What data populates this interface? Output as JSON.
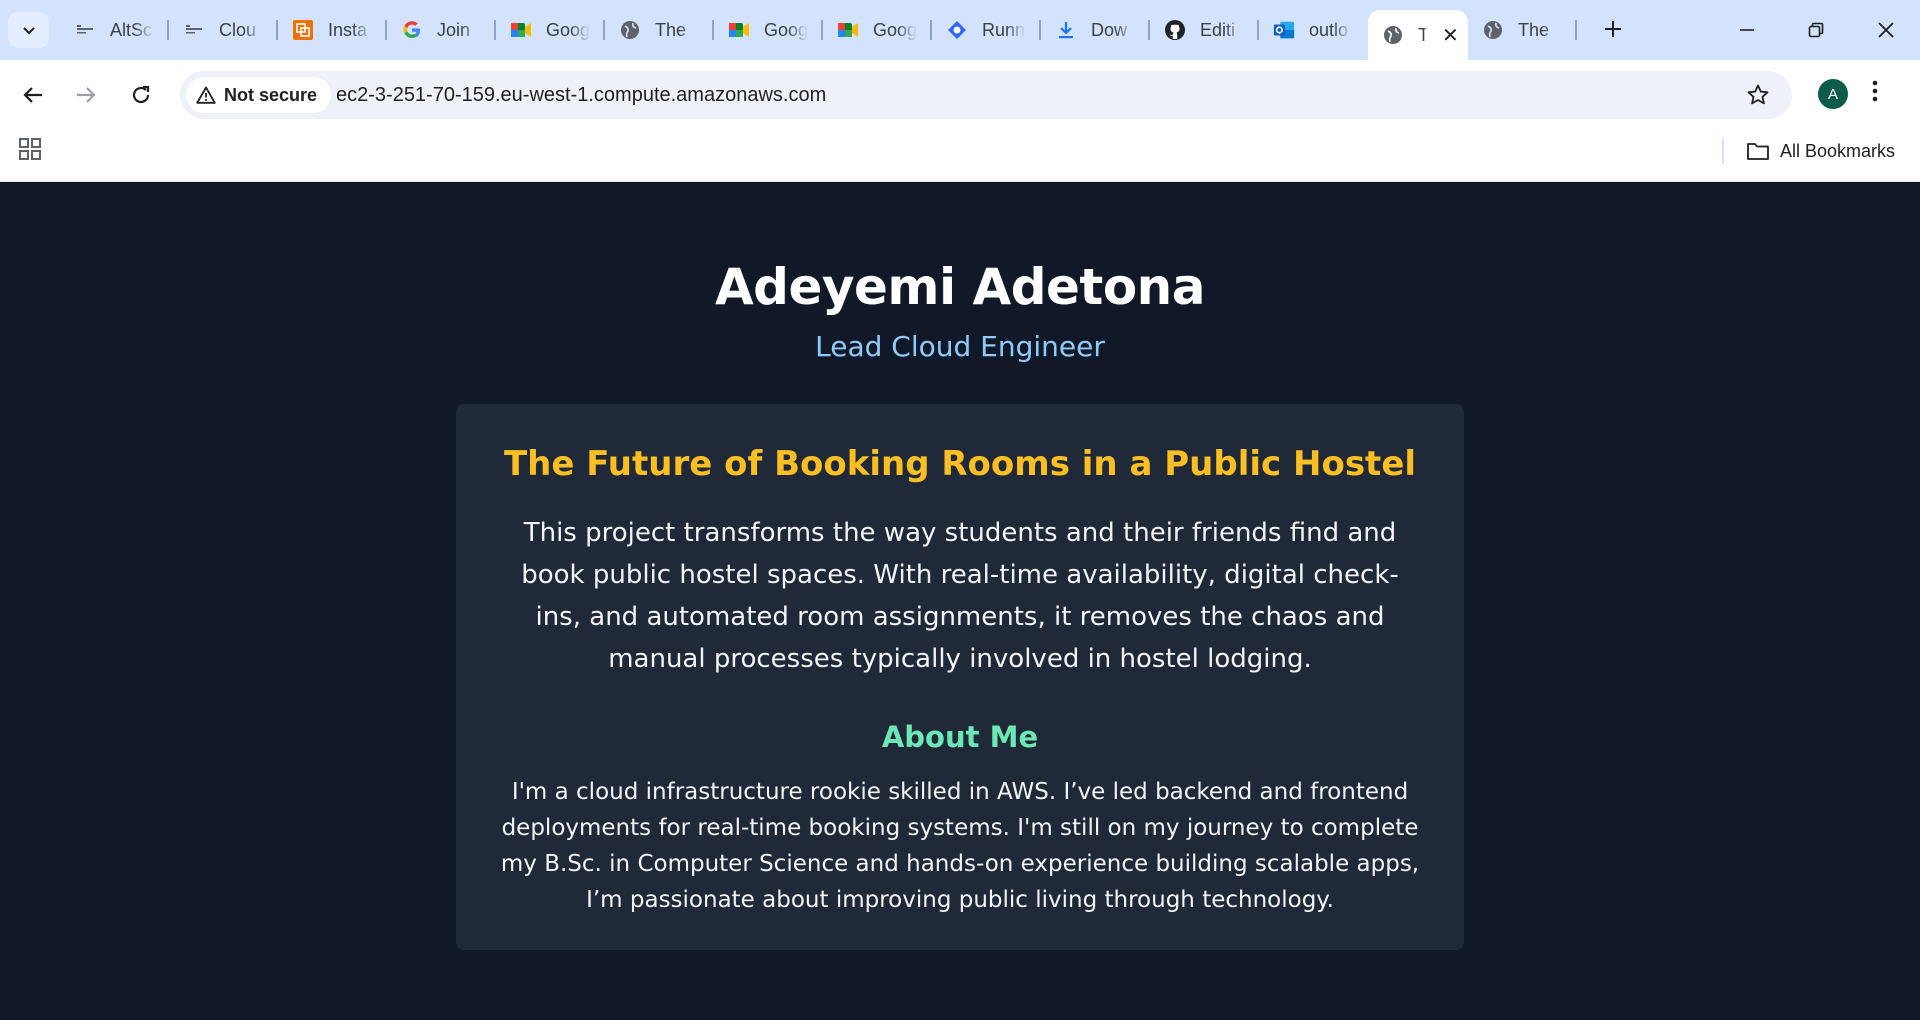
{
  "browser": {
    "tabs": [
      {
        "title": "AltSc",
        "icon": "folder-icon"
      },
      {
        "title": "Clou",
        "icon": "folder-icon"
      },
      {
        "title": "Insta",
        "icon": "aws-instance-icon"
      },
      {
        "title": "Join",
        "icon": "google-icon"
      },
      {
        "title": "Goog",
        "icon": "google-meet-icon"
      },
      {
        "title": "The",
        "icon": "globe-icon"
      },
      {
        "title": "Goog",
        "icon": "google-meet-icon"
      },
      {
        "title": "Goog",
        "icon": "google-meet-icon"
      },
      {
        "title": "Runn",
        "icon": "run-icon"
      },
      {
        "title": "Dow",
        "icon": "download-icon"
      },
      {
        "title": "Editi",
        "icon": "github-icon"
      },
      {
        "title": "outlo",
        "icon": "outlook-icon"
      },
      {
        "title": "T",
        "icon": "globe-icon",
        "active": true
      },
      {
        "title": "The",
        "icon": "globe-icon"
      }
    ],
    "security_label": "Not secure",
    "url": "ec2-3-251-70-159.eu-west-1.compute.amazonaws.com",
    "profile_initial": "A",
    "bookmarks_label": "All Bookmarks"
  },
  "profile": {
    "name": "Adeyemi Adetona",
    "role": "Lead Cloud Engineer"
  },
  "project": {
    "title": "The Future of Booking Rooms in a Public Hostel",
    "description": "This project transforms the way students and their friends find and book public hostel spaces. With real-time availability, digital check-ins, and automated room assignments, it removes the chaos and manual processes typically involved in hostel lodging."
  },
  "about": {
    "heading": "About Me",
    "text": "I'm a cloud infrastructure rookie skilled in AWS. I’ve led backend and frontend deployments for real-time booking systems. I'm still on my journey to complete my B.Sc. in Computer Science and hands-on experience building scalable apps, I’m passionate about improving public living through technology."
  },
  "colors": {
    "page_bg": "#111827",
    "card_bg": "#1f2937",
    "role": "#90caf9",
    "project_title": "#fbbf24",
    "about_heading": "#6ee7b7"
  }
}
